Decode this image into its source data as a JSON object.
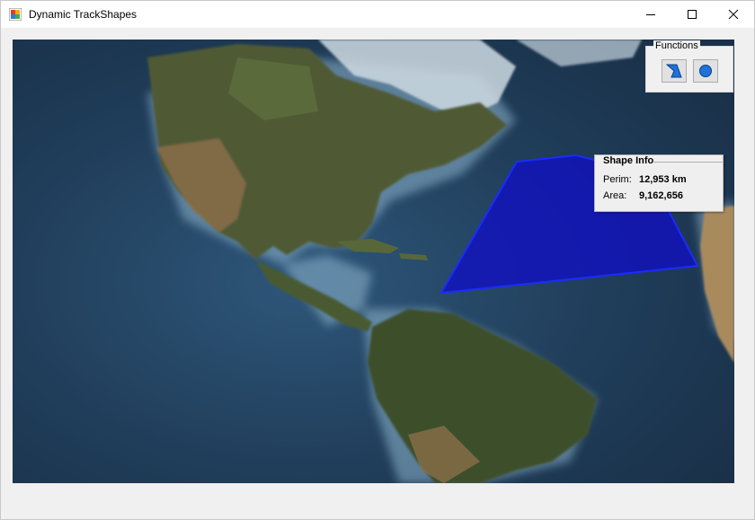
{
  "window": {
    "title": "Dynamic TrackShapes",
    "app_icon": "app-window-icon",
    "controls": [
      "minimize-icon",
      "maximize-icon",
      "close-icon"
    ]
  },
  "map": {
    "description_icon": "world-map",
    "track_shape": {
      "type": "polygon",
      "fill_color": "#1010c0",
      "stroke_color": "#1a2cff"
    }
  },
  "functions": {
    "label": "Functions",
    "buttons": [
      {
        "name": "polygon-tool",
        "icon": "polygon-icon"
      },
      {
        "name": "circle-tool",
        "icon": "circle-icon"
      }
    ],
    "accent": "#1e72d8"
  },
  "shape_info": {
    "title": "Shape Info",
    "perim_label": "Perim:",
    "perim_value": "12,953 km",
    "area_label": "Area:",
    "area_value": "9,162,656"
  }
}
